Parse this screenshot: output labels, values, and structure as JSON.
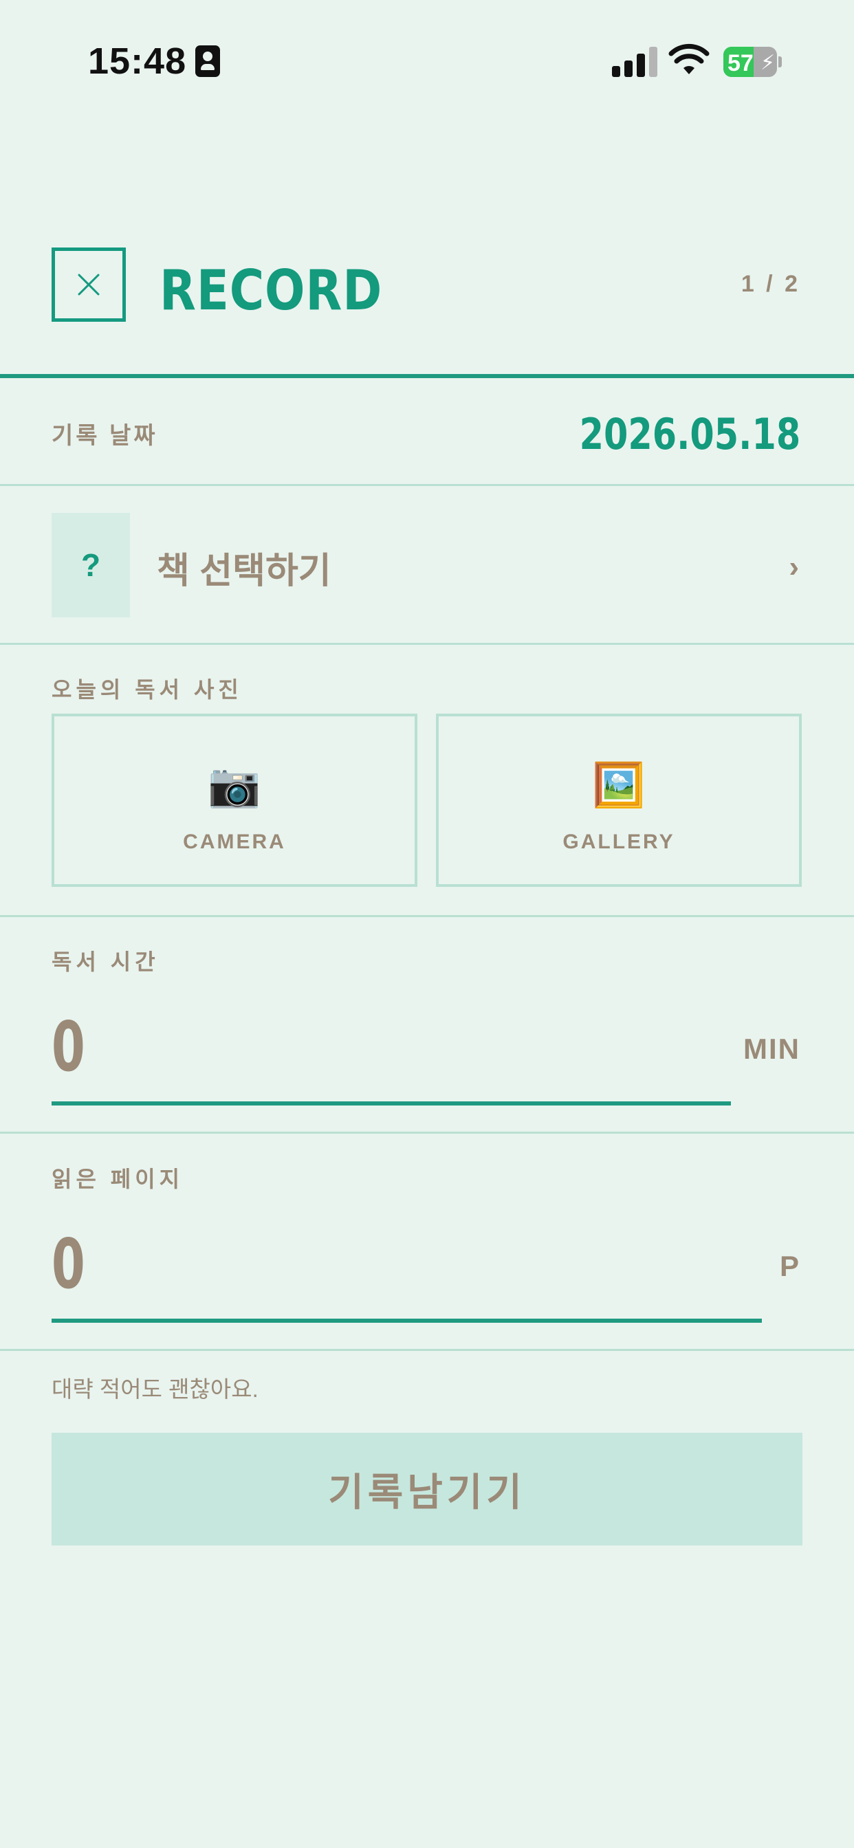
{
  "status_bar": {
    "time": "15:48",
    "battery_percent": "57",
    "battery_level": 0.57,
    "signal_bars_active": 3,
    "icons": [
      "id-card-icon",
      "cellular-signal-icon",
      "wifi-icon",
      "battery-charging-icon"
    ]
  },
  "header": {
    "close_icon": "close-icon",
    "title": "RECORD",
    "step": "1 / 2"
  },
  "record_date": {
    "label": "기록 날짜",
    "value": "2026.05.18"
  },
  "book": {
    "placeholder_icon": "?",
    "label": "책 선택하기",
    "chevron": "›"
  },
  "photo": {
    "label": "오늘의 독서 사진",
    "camera": {
      "icon": "📷",
      "label": "CAMERA"
    },
    "gallery": {
      "icon": "🖼️",
      "label": "GALLERY"
    }
  },
  "reading_time": {
    "label": "독서 시간",
    "value": "0",
    "unit": "MIN"
  },
  "pages_read": {
    "label": "읽은 페이지",
    "value": "0",
    "unit": "P"
  },
  "hint": "대략 적어도 괜찮아요.",
  "submit_label": "기록남기기",
  "colors": {
    "background": "#e9f4ef",
    "accent": "#149a7d",
    "muted_text": "#9a8a77",
    "divider": "#b9e0d2",
    "button_bg": "#c6e7de"
  }
}
